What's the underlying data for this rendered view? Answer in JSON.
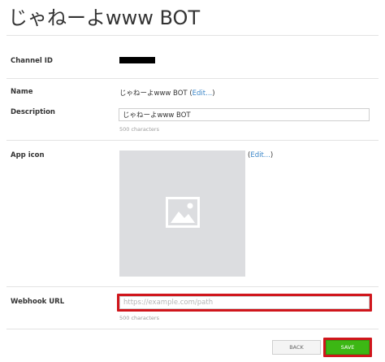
{
  "page": {
    "title": "じゃねーよwww BOT"
  },
  "channel_id": {
    "label": "Channel ID"
  },
  "name": {
    "label": "Name",
    "value": "じゃねーよwww BOT",
    "edit_open": " (",
    "edit_label": "Edit...",
    "edit_close": ")"
  },
  "description": {
    "label": "Description",
    "value": "じゃねーよwww BOT",
    "hint": "500 characters"
  },
  "app_icon": {
    "label": "App icon",
    "edit_open": "(",
    "edit_label": "Edit...",
    "edit_close": ")",
    "icon": "image-placeholder-icon"
  },
  "webhook": {
    "label": "Webhook URL",
    "value": "",
    "placeholder": "https://example.com/path",
    "hint": "500 characters"
  },
  "actions": {
    "back_label": "BACK",
    "save_label": "SAVE"
  },
  "colors": {
    "highlight": "#d0161c",
    "save_button": "#3cb714",
    "link": "#3a85c8",
    "icon_placeholder_bg": "#dcdde0"
  }
}
